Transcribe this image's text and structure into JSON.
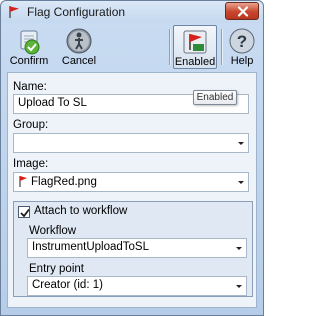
{
  "window": {
    "title": "Flag Configuration"
  },
  "toolbar": {
    "confirm_label": "Confirm",
    "cancel_label": "Cancel",
    "enabled_label": "Enabled",
    "help_label": "Help"
  },
  "form": {
    "name_label": "Name:",
    "name_value": "Upload To SL",
    "enabled_tooltip": "Enabled",
    "group_label": "Group:",
    "group_value": "",
    "image_label": "Image:",
    "image_value": "FlagRed.png",
    "attach_label": "Attach to workflow",
    "attach_checked": true,
    "workflow_label": "Workflow",
    "workflow_value": "InstrumentUploadToSL",
    "entry_label": "Entry point",
    "entry_value": "Creator (id: 1)"
  },
  "colors": {
    "window_bg": "#b6cde9",
    "panel_bg": "#eef3f9",
    "close_button": "#c8462c",
    "confirm_icon": "#5bb33a",
    "flag_red": "#d6201a"
  },
  "icons": {
    "app": "flag-icon",
    "close": "close-icon",
    "confirm": "confirm-icon",
    "cancel": "cancel-icon",
    "enabled": "enabled-icon",
    "help": "help-icon",
    "image_flag": "red-flag-icon"
  }
}
